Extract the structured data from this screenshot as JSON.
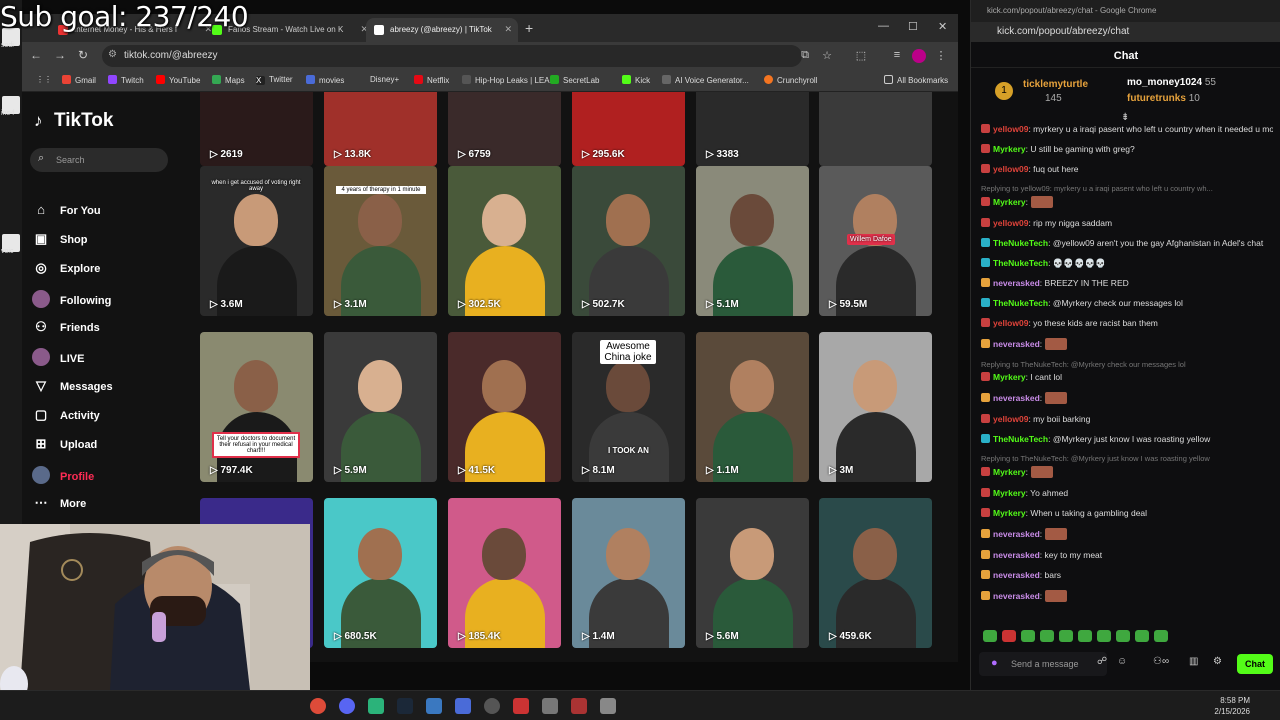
{
  "overlay": {
    "sub_goal": "Sub goal: 237/240"
  },
  "desktop_labels": [
    "sodi",
    "ins-f",
    "voic"
  ],
  "browser": {
    "tabs": [
      {
        "title": "Internet Money - His & Hers f",
        "color": "#e33"
      },
      {
        "title": "Fanos Stream - Watch Live on K",
        "color": "#53fc18"
      },
      {
        "title": "abreezy (@abreezy) | TikTok",
        "color": "#fff"
      }
    ],
    "url": "tiktok.com/@abreezy",
    "bookmarks": [
      {
        "label": "Gmail",
        "color": "#ea4335"
      },
      {
        "label": "Twitch",
        "color": "#9146ff"
      },
      {
        "label": "YouTube",
        "color": "#ff0000"
      },
      {
        "label": "Maps",
        "color": "#34a853"
      },
      {
        "label": "Twitter",
        "color": "#222"
      },
      {
        "label": "movies",
        "color": "#4a6bd8"
      },
      {
        "label": "Disney+",
        "color": "#113ccf"
      },
      {
        "label": "Netflix",
        "color": "#e50914"
      },
      {
        "label": "Hip-Hop Leaks | LEA...",
        "color": "#555"
      },
      {
        "label": "SecretLab",
        "color": "#2a2"
      },
      {
        "label": "Kick",
        "color": "#53fc18"
      },
      {
        "label": "AI Voice Generator...",
        "color": "#666"
      },
      {
        "label": "Crunchyroll",
        "color": "#f47521"
      }
    ],
    "all_bookmarks": "All Bookmarks"
  },
  "tiktok": {
    "logo": "TikTok",
    "search_placeholder": "Search",
    "nav": [
      {
        "label": "For You",
        "icon": "home-icon",
        "glyph": "⌂"
      },
      {
        "label": "Shop",
        "icon": "shop-icon",
        "glyph": "▣"
      },
      {
        "label": "Explore",
        "icon": "compass-icon",
        "glyph": "◎"
      },
      {
        "label": "Following",
        "icon": "avatar",
        "glyph": ""
      },
      {
        "label": "Friends",
        "icon": "friends-icon",
        "glyph": "⚇"
      },
      {
        "label": "LIVE",
        "icon": "avatar",
        "glyph": ""
      },
      {
        "label": "Messages",
        "icon": "messages-icon",
        "glyph": "▽"
      },
      {
        "label": "Activity",
        "icon": "activity-icon",
        "glyph": "▢"
      },
      {
        "label": "Upload",
        "icon": "upload-icon",
        "glyph": "⊞"
      },
      {
        "label": "Profile",
        "icon": "avatar",
        "glyph": ""
      },
      {
        "label": "More",
        "icon": "more-icon",
        "glyph": "⋯"
      }
    ],
    "rows": [
      {
        "views": [
          "2619",
          "13.8K",
          "6759",
          "295.6K",
          "3383",
          ""
        ]
      },
      {
        "views": [
          "3.6M",
          "3.1M",
          "302.5K",
          "502.7K",
          "5.1M",
          "59.5M"
        ]
      },
      {
        "views": [
          "797.4K",
          "5.9M",
          "41.5K",
          "8.1M",
          "1.1M",
          "3M"
        ]
      },
      {
        "views": [
          "",
          "680.5K",
          "185.4K",
          "1.4M",
          "5.6M",
          "459.6K"
        ]
      }
    ],
    "captions": {
      "r1c1": "when i get accused of voting right away",
      "r1c2": "4 years of therapy in 1 minute",
      "r1c6": "Willem Dafoe",
      "r2c1": "Tell your doctors to document their refusal in your medical chart!!!",
      "r2c4a": "Awesome China joke",
      "r2c4b": "I TOOK AN"
    }
  },
  "chat": {
    "window_title": "kick.com/popout/abreezy/chat - Google Chrome",
    "url": "kick.com/popout/abreezy/chat",
    "header": "Chat",
    "leaders": [
      {
        "name": "ticklemyturtle",
        "count": "145"
      },
      {
        "name": "mo_money1024",
        "count": "55"
      },
      {
        "name": "futuretrunks",
        "count": "10"
      }
    ],
    "messages": [
      {
        "user": "yellow09",
        "color": "#e0433a",
        "text": ": myrkery u a iraqi pasent who left u country when it needed u most",
        "reply": ""
      },
      {
        "user": "Myrkery",
        "color": "#53fc18",
        "text": ": U still be gaming with greg?",
        "reply": ""
      },
      {
        "user": "yellow09",
        "color": "#e0433a",
        "text": ": fuq out here",
        "reply": ""
      },
      {
        "user": "Myrkery",
        "color": "#53fc18",
        "text": ":",
        "reply": "Replying to yellow09: myrkery u a iraqi pasent who left u country wh..."
      },
      {
        "user": "yellow09",
        "color": "#e0433a",
        "text": ": rip my nigga saddam",
        "reply": ""
      },
      {
        "user": "TheNukeTech",
        "color": "#53fc18",
        "text": ": @yellow09 aren't you the gay Afghanistan in Adel's chat",
        "reply": ""
      },
      {
        "user": "TheNukeTech",
        "color": "#53fc18",
        "text": ": 💀💀💀💀💀",
        "reply": ""
      },
      {
        "user": "neverasked",
        "color": "#c98ce8",
        "text": ": BREEZY IN THE RED",
        "reply": ""
      },
      {
        "user": "TheNukeTech",
        "color": "#53fc18",
        "text": ": @Myrkery check our messages lol",
        "reply": ""
      },
      {
        "user": "yellow09",
        "color": "#e0433a",
        "text": ": yo these kids are racist ban them",
        "reply": ""
      },
      {
        "user": "neverasked",
        "color": "#c98ce8",
        "text": ":",
        "reply": ""
      },
      {
        "user": "Myrkery",
        "color": "#53fc18",
        "text": ": I cant lol",
        "reply": "Replying to TheNukeTech: @Myrkery check our messages lol"
      },
      {
        "user": "neverasked",
        "color": "#c98ce8",
        "text": ":",
        "reply": ""
      },
      {
        "user": "yellow09",
        "color": "#e0433a",
        "text": ": my boii barking",
        "reply": ""
      },
      {
        "user": "TheNukeTech",
        "color": "#53fc18",
        "text": ": @Myrkery just know I was roasting yellow",
        "reply": ""
      },
      {
        "user": "Myrkery",
        "color": "#53fc18",
        "text": ":",
        "reply": "Replying to TheNukeTech: @Myrkery just know I was roasting yellow"
      },
      {
        "user": "Myrkery",
        "color": "#53fc18",
        "text": ": Yo ahmed",
        "reply": ""
      },
      {
        "user": "Myrkery",
        "color": "#53fc18",
        "text": ": When u taking a gambling deal",
        "reply": ""
      },
      {
        "user": "neverasked",
        "color": "#c98ce8",
        "text": ":",
        "reply": ""
      },
      {
        "user": "neverasked",
        "color": "#c98ce8",
        "text": ": key to my meat",
        "reply": ""
      },
      {
        "user": "neverasked",
        "color": "#c98ce8",
        "text": ": bars",
        "reply": ""
      },
      {
        "user": "neverasked",
        "color": "#c98ce8",
        "text": ":",
        "reply": ""
      }
    ],
    "input_placeholder": "Send a message",
    "send_label": "Chat"
  },
  "taskbar": {
    "time": "8:58 PM",
    "date": "2/15/2026"
  }
}
